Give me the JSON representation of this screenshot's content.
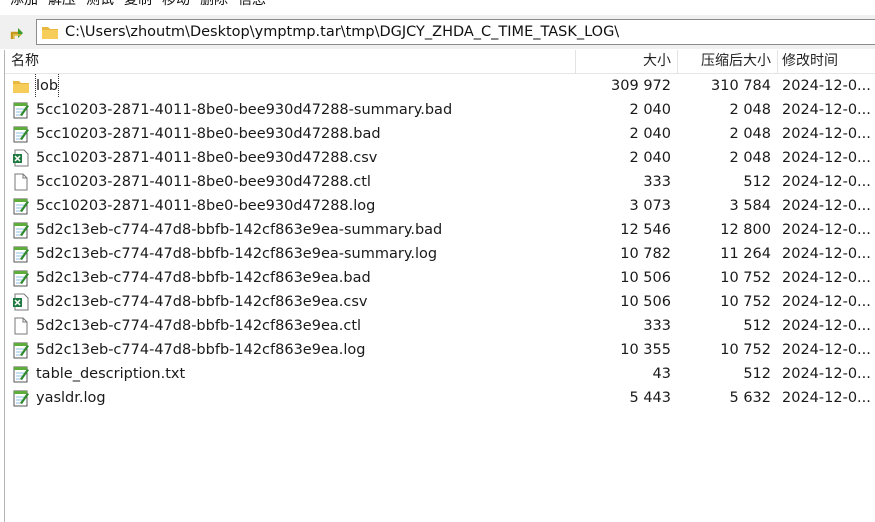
{
  "toolbar": {
    "items": [
      "添加",
      "解压",
      "测试",
      "复制",
      "移动",
      "删除",
      "信息"
    ]
  },
  "address": {
    "path": "C:\\Users\\zhoutm\\Desktop\\ymptmp.tar\\tmp\\DGJCY_ZHDA_C_TIME_TASK_LOG\\"
  },
  "columns": {
    "name": "名称",
    "size": "大小",
    "packed": "压缩后大小",
    "modified": "修改时间"
  },
  "files": [
    {
      "name": "lob",
      "size": "309 972",
      "packed": "310 784",
      "modified": "2024-12-0...",
      "icon": "folder-icon"
    },
    {
      "name": "5cc10203-2871-4011-8be0-bee930d47288-summary.bad",
      "size": "2 040",
      "packed": "2 048",
      "modified": "2024-12-0...",
      "icon": "notepad-file-icon"
    },
    {
      "name": "5cc10203-2871-4011-8be0-bee930d47288.bad",
      "size": "2 040",
      "packed": "2 048",
      "modified": "2024-12-0...",
      "icon": "notepad-file-icon"
    },
    {
      "name": "5cc10203-2871-4011-8be0-bee930d47288.csv",
      "size": "2 040",
      "packed": "2 048",
      "modified": "2024-12-0...",
      "icon": "excel-file-icon"
    },
    {
      "name": "5cc10203-2871-4011-8be0-bee930d47288.ctl",
      "size": "333",
      "packed": "512",
      "modified": "2024-12-0...",
      "icon": "blank-file-icon"
    },
    {
      "name": "5cc10203-2871-4011-8be0-bee930d47288.log",
      "size": "3 073",
      "packed": "3 584",
      "modified": "2024-12-0...",
      "icon": "notepad-file-icon"
    },
    {
      "name": "5d2c13eb-c774-47d8-bbfb-142cf863e9ea-summary.bad",
      "size": "12 546",
      "packed": "12 800",
      "modified": "2024-12-0...",
      "icon": "notepad-file-icon"
    },
    {
      "name": "5d2c13eb-c774-47d8-bbfb-142cf863e9ea-summary.log",
      "size": "10 782",
      "packed": "11 264",
      "modified": "2024-12-0...",
      "icon": "notepad-file-icon"
    },
    {
      "name": "5d2c13eb-c774-47d8-bbfb-142cf863e9ea.bad",
      "size": "10 506",
      "packed": "10 752",
      "modified": "2024-12-0...",
      "icon": "notepad-file-icon"
    },
    {
      "name": "5d2c13eb-c774-47d8-bbfb-142cf863e9ea.csv",
      "size": "10 506",
      "packed": "10 752",
      "modified": "2024-12-0...",
      "icon": "excel-file-icon"
    },
    {
      "name": "5d2c13eb-c774-47d8-bbfb-142cf863e9ea.ctl",
      "size": "333",
      "packed": "512",
      "modified": "2024-12-0...",
      "icon": "blank-file-icon"
    },
    {
      "name": "5d2c13eb-c774-47d8-bbfb-142cf863e9ea.log",
      "size": "10 355",
      "packed": "10 752",
      "modified": "2024-12-0...",
      "icon": "notepad-file-icon"
    },
    {
      "name": "table_description.txt",
      "size": "43",
      "packed": "512",
      "modified": "2024-12-0...",
      "icon": "notepad-file-icon"
    },
    {
      "name": "yasldr.log",
      "size": "5 443",
      "packed": "5 632",
      "modified": "2024-12-0...",
      "icon": "notepad-file-icon"
    }
  ]
}
